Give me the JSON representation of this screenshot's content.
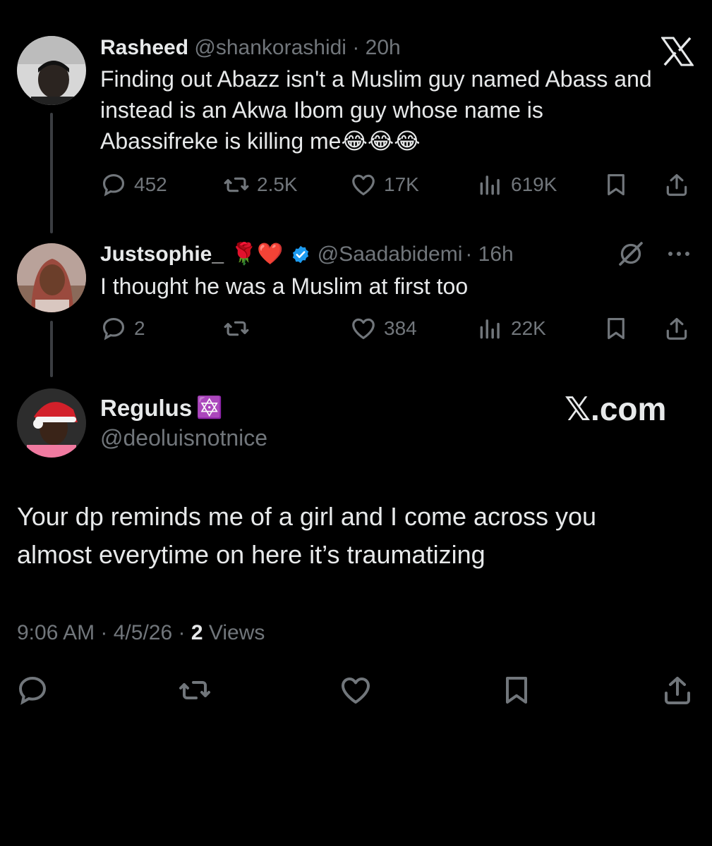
{
  "tweets": [
    {
      "name": "Rasheed",
      "handle": "@shankorashidi",
      "time": "· 20h",
      "text_lines": [
        "Finding out Abazz isn't a Muslim guy named Abass and",
        "instead is an Akwa Ibom guy whose name is",
        "Abassifreke is killing me😂😂😂"
      ],
      "replies": "452",
      "reposts": "2.5K",
      "likes": "17K",
      "views": "619K"
    },
    {
      "name": "Justsophie_",
      "name_emojis": "🌹❤️",
      "handle": "@Saadabidemi",
      "time": "· 16h",
      "text_lines": [
        "I thought he was a Muslim at first too"
      ],
      "replies": "2",
      "reposts": "",
      "likes": "384",
      "views": "22K"
    }
  ],
  "main": {
    "name": "Regulus",
    "name_emoji": "🔯",
    "handle": "@deoluisnotnice",
    "text_lines": [
      "Your dp reminds me of a girl and I come across you",
      "almost everytime on here it’s traumatizing"
    ],
    "time": "9:06 AM",
    "date": "4/5/26",
    "views_count": "2",
    "views_label": "Views"
  },
  "watermark": "𝕏.com",
  "icons": {
    "x_logo": "x-logo-icon",
    "reply": "reply-icon",
    "repost": "repost-icon",
    "like": "heart-icon",
    "views": "views-icon",
    "bookmark": "bookmark-icon",
    "share": "share-icon",
    "grok": "grok-icon",
    "more": "more-icon",
    "verified": "verified-badge-icon"
  },
  "colors": {
    "background": "#000000",
    "text": "#e7e9ea",
    "muted": "#71767b",
    "verified": "#1d9bf0"
  }
}
